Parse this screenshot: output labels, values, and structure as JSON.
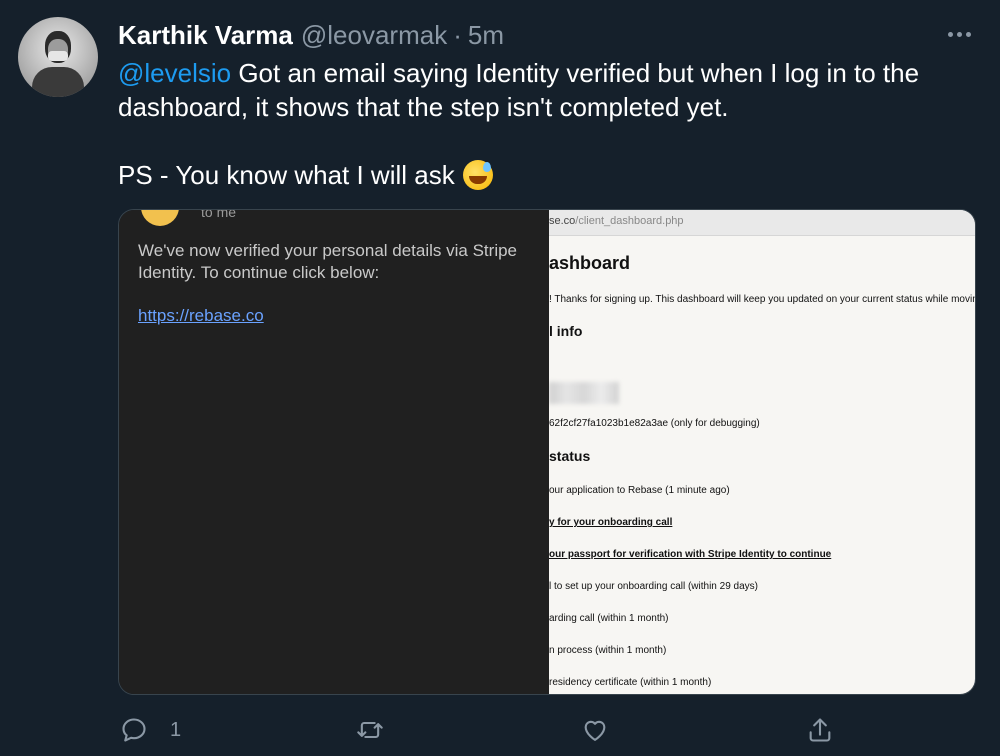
{
  "tweet": {
    "author_name": "Karthik Varma",
    "handle": "@leovarmak",
    "separator": "·",
    "time": "5m",
    "mention": "@levelsio",
    "text_line1": " Got an email saying Identity verified but when I log in to the dashboard, it shows that the step isn't completed yet.",
    "text_line2": "PS - You know what I will ask",
    "emoji": "sweat-smile-emoji"
  },
  "email": {
    "to_label": "to me",
    "body": "We've now verified your personal details via Stripe Identity. To continue click below:",
    "link": "https://rebase.co"
  },
  "dashboard": {
    "url_host": "se.co",
    "url_path": "/client_dashboard.php",
    "title": "ashboard",
    "welcome": "! Thanks for signing up. This dashboard will keep you updated on your current status while moving th",
    "section_info": "l info",
    "debug_id": "62f2cf27fa1023b1e82a3ae (only for debugging)",
    "section_status": "status",
    "status_items": [
      "our application to Rebase (1 minute ago)",
      "y for your onboarding call",
      "our passport for verification with Stripe Identity to continue",
      "l to set up your onboarding call (within 29 days)",
      "arding call (within 1 month)",
      "n process (within 1 month)",
      "residency certificate (within 1 month)"
    ]
  },
  "actions": {
    "reply_count": "1",
    "icons": [
      "reply-icon",
      "retweet-icon",
      "like-icon",
      "share-icon"
    ]
  },
  "colors": {
    "background": "#15202b",
    "accent": "#1d9bf0",
    "muted": "#8b98a5"
  }
}
